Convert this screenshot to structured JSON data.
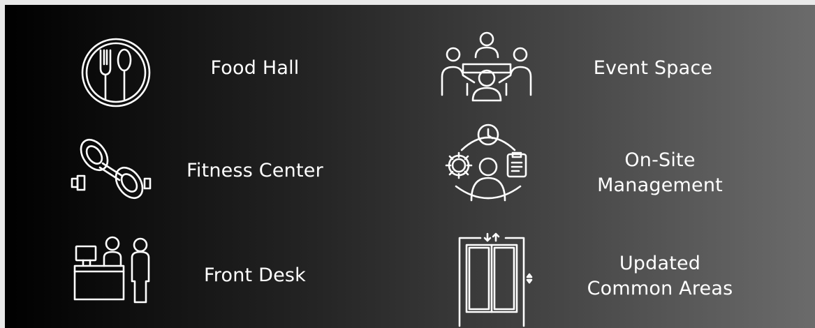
{
  "amenities": [
    {
      "id": "food-hall",
      "label": "Food Hall",
      "icon": "plate-fork-spoon-icon"
    },
    {
      "id": "fitness-center",
      "label": "Fitness Center",
      "icon": "dumbbell-icon"
    },
    {
      "id": "front-desk",
      "label": "Front Desk",
      "icon": "reception-desk-icon"
    },
    {
      "id": "event-space",
      "label": "Event Space",
      "icon": "meeting-table-icon"
    },
    {
      "id": "on-site-management",
      "label_line1": "On-Site",
      "label_line2": "Management",
      "icon": "manager-clock-gear-clipboard-icon"
    },
    {
      "id": "updated-common-areas",
      "label_line1": "Updated",
      "label_line2": "Common Areas",
      "icon": "elevator-icon"
    }
  ],
  "colors": {
    "text": "#ffffff",
    "icon_stroke": "#ffffff",
    "gradient_start": "#000000",
    "gradient_end": "#6b6b6b",
    "frame": "#e9e9e9"
  }
}
